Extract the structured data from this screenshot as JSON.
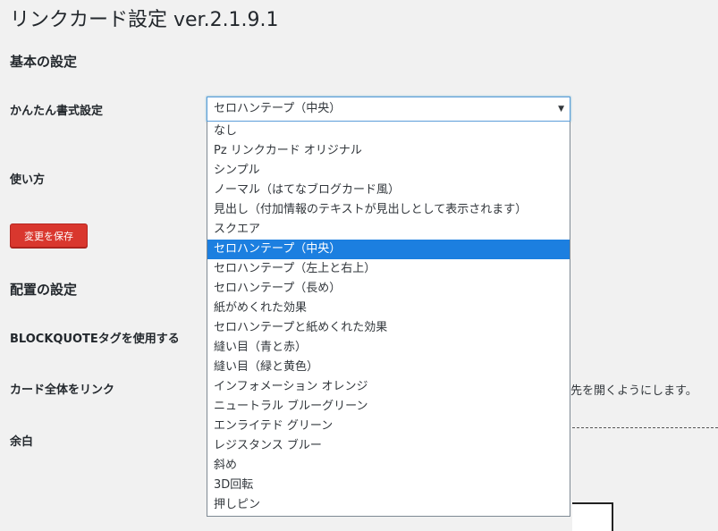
{
  "page": {
    "title": "リンクカード設定 ver.2.1.9.1"
  },
  "sections": {
    "basic_title": "基本の設定",
    "placement_title": "配置の設定"
  },
  "labels": {
    "easy_format": "かんたん書式設定",
    "usage": "使い方",
    "blockquote": "BLOCKQUOTEタグを使用する",
    "link_whole_card": "カード全体をリンク",
    "margin": "余白"
  },
  "save_button": {
    "label": "変更を保存"
  },
  "select": {
    "value": "セロハンテープ（中央）",
    "options": [
      "なし",
      "Pz リンクカード オリジナル",
      "シンプル",
      "ノーマル（はてなブログカード風）",
      "見出し（付加情報のテキストが見出しとして表示されます）",
      "スクエア",
      "セロハンテープ（中央）",
      "セロハンテープ（左上と右上）",
      "セロハンテープ（長め）",
      "紙がめくれた効果",
      "セロハンテープと紙めくれた効果",
      "縫い目（青と赤）",
      "縫い目（緑と黄色）",
      "インフォメーション オレンジ",
      "ニュートラル ブルーグリーン",
      "エンライテド グリーン",
      "レジスタンス ブルー",
      "斜め",
      "3D回転",
      "押しピン"
    ],
    "selected_index": 6
  },
  "partial_text": {
    "link_description_fragment": "先を開くようにします。"
  },
  "colors": {
    "save_button_bg": "#d9372e",
    "selected_option_bg": "#1c7fe0",
    "select_focus_border": "#5b9dd9"
  }
}
